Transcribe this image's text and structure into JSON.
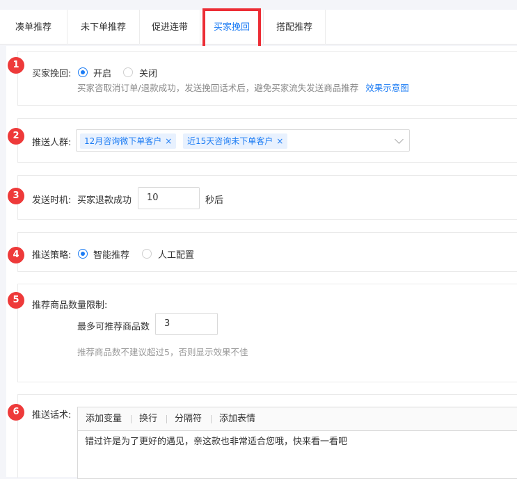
{
  "tabs": [
    {
      "label": "凑单推荐"
    },
    {
      "label": "未下单推荐"
    },
    {
      "label": "促进连带"
    },
    {
      "label": "买家挽回",
      "active": true
    },
    {
      "label": "搭配推荐"
    }
  ],
  "colors": {
    "accent": "#1c7cf4",
    "badge": "#ee3a3a",
    "highlight": "#ec2d35"
  },
  "sections": {
    "retain": {
      "step": "1",
      "label": "买家挽回:",
      "options": [
        "开启",
        "关闭"
      ],
      "selected": "开启",
      "hint": "买家咨取消订单/退款成功，发送挽回话术后，避免买家流失发送商品推荐",
      "link": "效果示意图"
    },
    "audience": {
      "step": "2",
      "label": "推送人群:",
      "tags": [
        "12月咨询微下单客户",
        "近15天咨询未下单客户"
      ],
      "tag_close": "×"
    },
    "timing": {
      "step": "3",
      "label": "发送时机:",
      "trigger": "买家退款成功",
      "value": "10",
      "unit": "秒后"
    },
    "strategy": {
      "step": "4",
      "label": "推送策略:",
      "options": [
        "智能推荐",
        "人工配置"
      ],
      "selected": "智能推荐"
    },
    "limit": {
      "step": "5",
      "label": "推荐商品数量限制:",
      "sub_label": "最多可推荐商品数",
      "value": "3",
      "hint": "推荐商品数不建议超过5，否则显示效果不佳"
    },
    "script": {
      "step": "6",
      "label": "推送话术:",
      "tools": [
        "添加变量",
        "换行",
        "分隔符",
        "添加表情"
      ],
      "text": "错过许是为了更好的遇见，亲这款也非常适合您哦，快来看一看吧"
    }
  }
}
